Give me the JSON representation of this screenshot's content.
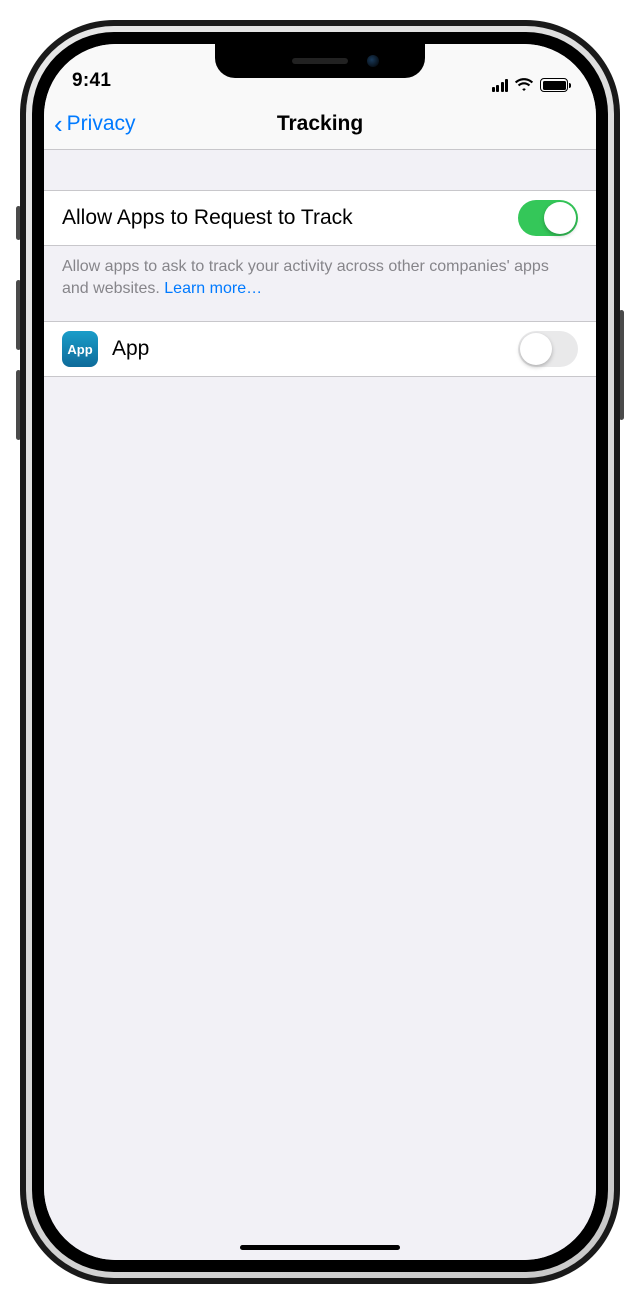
{
  "statusBar": {
    "time": "9:41"
  },
  "nav": {
    "back": "Privacy",
    "title": "Tracking"
  },
  "allowRow": {
    "label": "Allow Apps to Request to Track",
    "toggleOn": true
  },
  "footer": {
    "text": "Allow apps to ask to track your activity across other companies' apps and websites. ",
    "link": "Learn more…"
  },
  "apps": [
    {
      "iconLabel": "App",
      "name": "App",
      "toggleOn": false
    }
  ]
}
